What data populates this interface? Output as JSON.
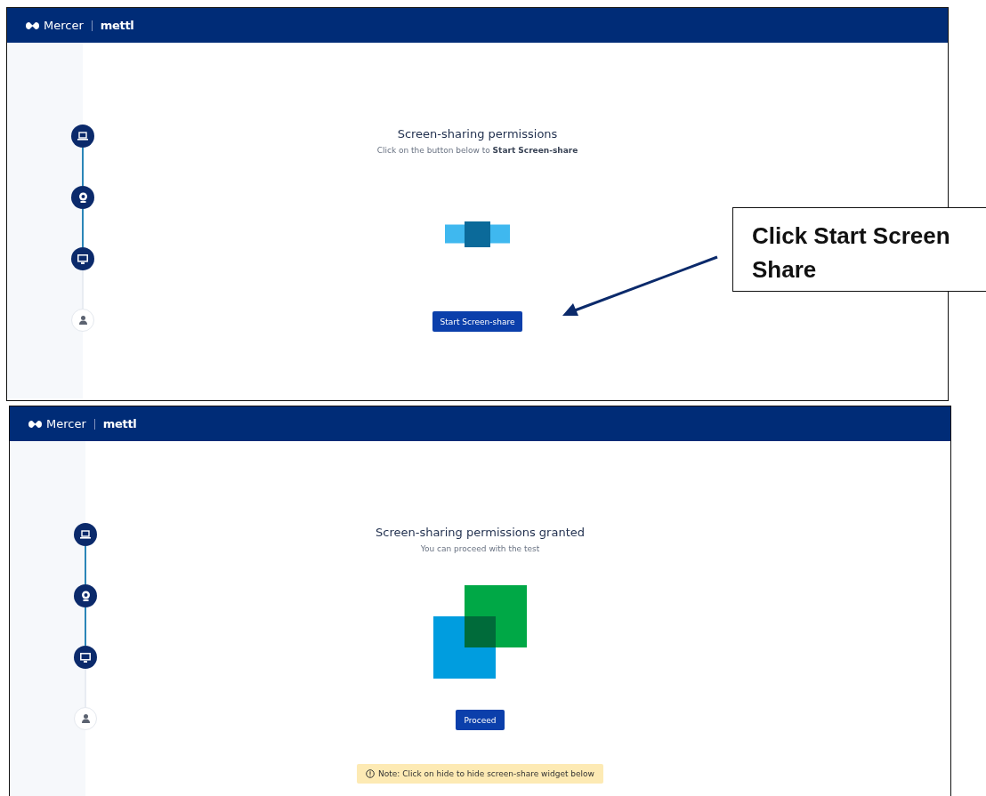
{
  "panels": [
    {
      "header": {
        "brand": "Mercer",
        "product": "mettl"
      },
      "steps": [
        {
          "kind": "laptop",
          "done": true
        },
        {
          "kind": "webcam",
          "done": true
        },
        {
          "kind": "monitor",
          "done": true
        },
        {
          "kind": "person",
          "done": false
        }
      ],
      "title": "Screen-sharing permissions",
      "subtitle": "Click on the button below to **Start Screen-share**",
      "graphic": {
        "kind": "waiting"
      },
      "button": "Start Screen-share"
    },
    {
      "header": {
        "brand": "Mercer",
        "product": "mettl"
      },
      "steps": [
        {
          "kind": "laptop",
          "done": true
        },
        {
          "kind": "webcam",
          "done": true
        },
        {
          "kind": "monitor",
          "done": true
        },
        {
          "kind": "person",
          "done": false
        }
      ],
      "title": "Screen-sharing permissions granted",
      "subtitle": "You can proceed with the test",
      "graphic": {
        "kind": "granted"
      },
      "button": "Proceed",
      "note": "Note: Click on hide to hide screen-share widget below"
    }
  ],
  "callout": {
    "text": "Click Start Screen Share"
  }
}
